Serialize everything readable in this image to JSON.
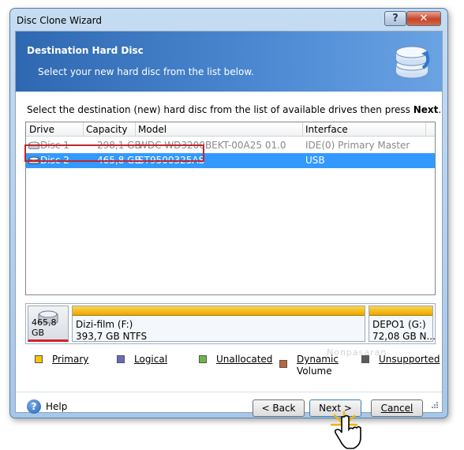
{
  "window": {
    "title": "Disc Clone Wizard",
    "help_glyph": "?",
    "close_glyph": "✕"
  },
  "header": {
    "title": "Destination Hard Disc",
    "subtitle": "Select your new hard disc from the list below.",
    "icon": "disc-stack-icon"
  },
  "instruction": {
    "text": "Select the destination (new) hard disc from the list of available drives then press ",
    "bold": "Next",
    "end": "."
  },
  "list": {
    "columns": [
      "Drive",
      "Capacity",
      "Model",
      "Interface"
    ],
    "rows": [
      {
        "drive": "Disc 1",
        "capacity": "298,1 GB",
        "model": "WDC WD3200BEKT-00A25 01.0",
        "interface": "IDE(0) Primary Master",
        "selected": false
      },
      {
        "drive": "Disc 2",
        "capacity": "465,8 GB",
        "model": "ST9500325AS",
        "interface": "USB",
        "selected": true
      }
    ]
  },
  "diskmap": {
    "disk_size": "465,8 GB",
    "partitions": [
      {
        "name": "Dizi-film (F:)",
        "info": "393,7 GB  NTFS"
      },
      {
        "name": "DEPO1 (G:)",
        "info": "72,08 GB  N..."
      }
    ],
    "watermark": "Nonpasaran"
  },
  "legend": {
    "items": [
      {
        "label": "Primary",
        "color": "#f7c600"
      },
      {
        "label": "Logical",
        "color": "#6a6ab8"
      },
      {
        "label": "Unallocated",
        "color": "#6ab840"
      },
      {
        "label_line1": "Dynamic",
        "label_line2": "Volume",
        "color": "#c0643a"
      },
      {
        "label": "Unsupported",
        "color": "#5a5a5a"
      }
    ]
  },
  "buttons": {
    "help": "Help",
    "back": "< Back",
    "next": "Next >",
    "cancel": "Cancel"
  }
}
